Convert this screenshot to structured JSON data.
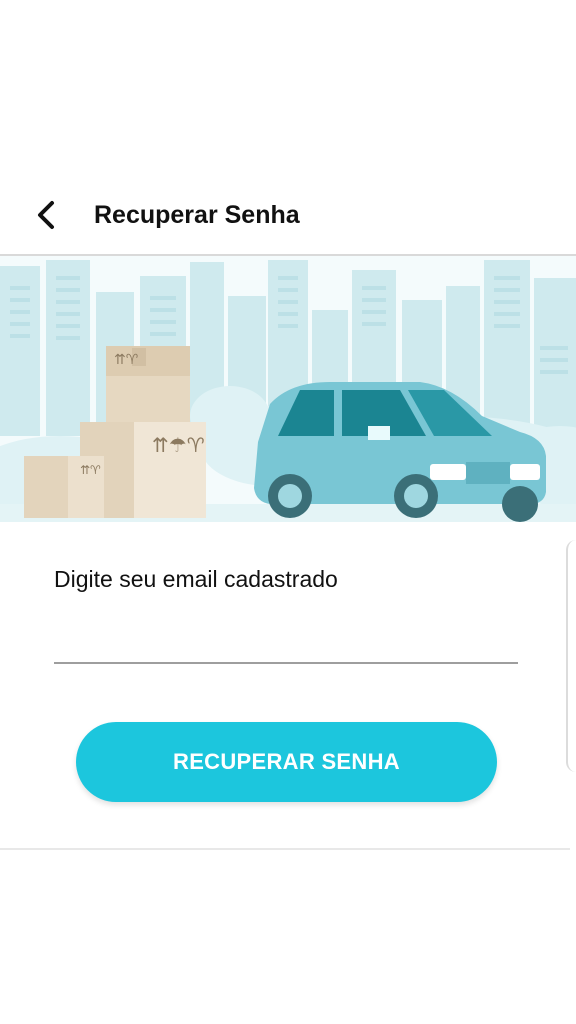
{
  "header": {
    "title": "Recuperar Senha",
    "back_icon": "back-arrow-icon"
  },
  "illustration": {
    "icons": [
      "city-skyline",
      "cardboard-boxes",
      "car"
    ],
    "colors": {
      "sky": "#f2fbfc",
      "buildings": "#bfe3e8",
      "car": "#6fc3d3",
      "boxes": "#e9dcc6"
    }
  },
  "form": {
    "email_label": "Digite seu email cadastrado",
    "email_value": "",
    "email_placeholder": "",
    "submit_label": "RECUPERAR SENHA"
  },
  "colors": {
    "accent": "#1cc6dd",
    "text": "#111111"
  }
}
